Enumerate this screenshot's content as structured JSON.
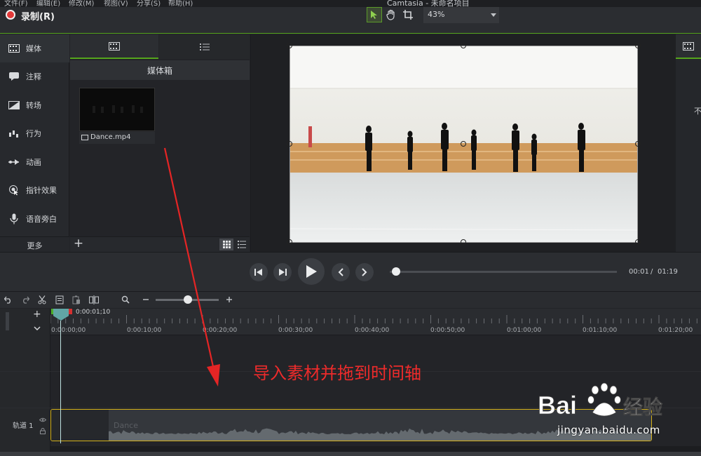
{
  "menu": {
    "items": [
      "文件(F)",
      "编辑(E)",
      "修改(M)",
      "视图(V)",
      "分享(S)",
      "帮助(H)"
    ],
    "app_title": "Camtasia - 未命名项目"
  },
  "topbar": {
    "record_label": "录制(R)",
    "zoom_value": "43%",
    "record_color": "#e33a3a",
    "accent_color": "#55a51c"
  },
  "sidebar": {
    "items": [
      {
        "label": "媒体",
        "icon": "film-strip-icon"
      },
      {
        "label": "注释",
        "icon": "annotation-icon"
      },
      {
        "label": "转场",
        "icon": "transition-icon"
      },
      {
        "label": "行为",
        "icon": "behavior-icon"
      },
      {
        "label": "动画",
        "icon": "animation-icon"
      },
      {
        "label": "指针效果",
        "icon": "cursor-effect-icon"
      },
      {
        "label": "语音旁白",
        "icon": "microphone-icon"
      }
    ],
    "more_label": "更多"
  },
  "media": {
    "bin_title": "媒体箱",
    "clip_name": "Dance.mp4"
  },
  "right_panel": {
    "text": "不"
  },
  "playback": {
    "current_time": "00:01",
    "separator": "/",
    "total_time": "01:19"
  },
  "timeline": {
    "playhead_time": "0:00:01;10",
    "ruler_labels": [
      "0:00:00;00",
      "0:00:10;00",
      "0:00:20;00",
      "0:00:30;00",
      "0:00:40;00",
      "0:00:50;00",
      "0:01:00;00",
      "0:01:10;00",
      "0:01:20;00"
    ],
    "track_label": "轨道 1",
    "clip_title": "Dance"
  },
  "annotation": {
    "text": "导入素材并拖到时间轴",
    "color": "#ee2b2b"
  },
  "watermark": {
    "brand": "Bai 经验",
    "url": "jingyan.baidu.com"
  }
}
